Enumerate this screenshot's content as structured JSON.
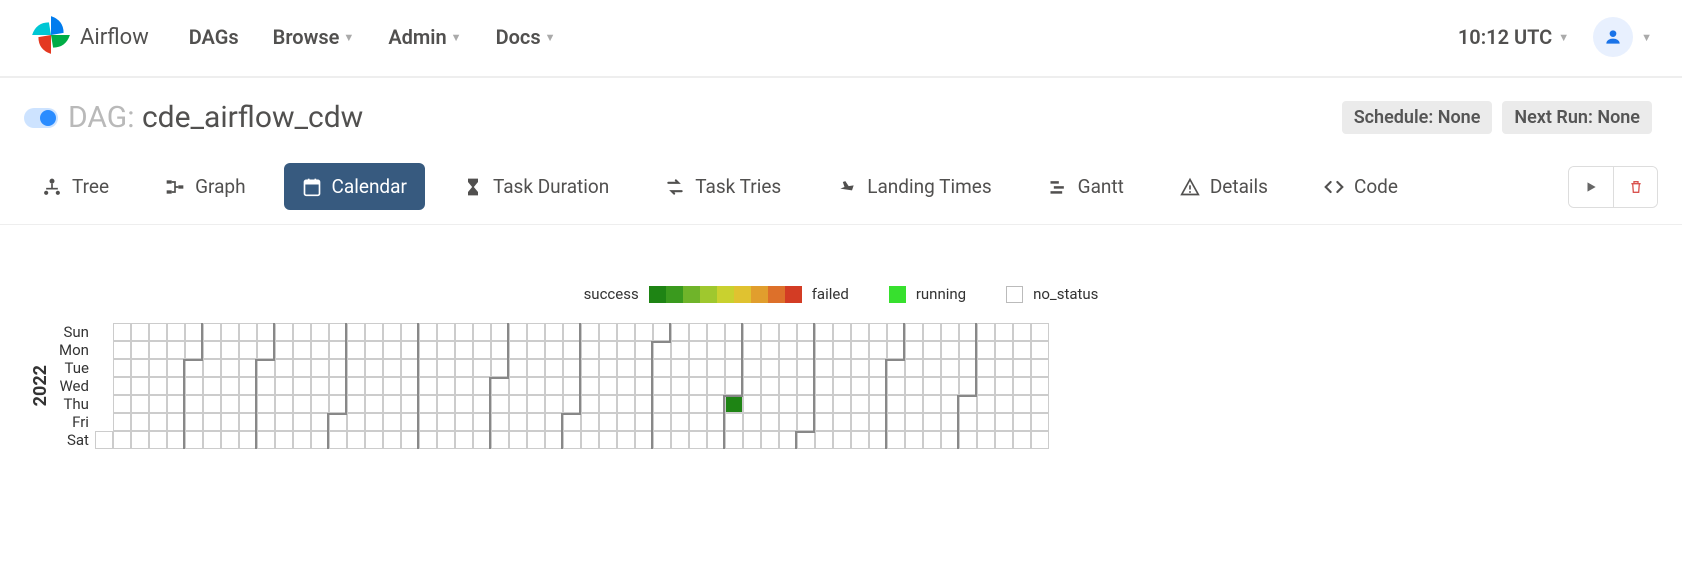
{
  "brand": "Airflow",
  "nav": {
    "items": [
      "DAGs",
      "Browse",
      "Admin",
      "Docs"
    ],
    "dropdowns": [
      false,
      true,
      true,
      true
    ],
    "clock": "10:12 UTC"
  },
  "dag": {
    "label_prefix": "DAG:",
    "name": "cde_airflow_cdw",
    "schedule_label": "Schedule: None",
    "next_run_label": "Next Run: None"
  },
  "tabs": [
    {
      "id": "tree",
      "label": "Tree"
    },
    {
      "id": "graph",
      "label": "Graph"
    },
    {
      "id": "calendar",
      "label": "Calendar"
    },
    {
      "id": "task-duration",
      "label": "Task Duration"
    },
    {
      "id": "task-tries",
      "label": "Task Tries"
    },
    {
      "id": "landing-times",
      "label": "Landing Times"
    },
    {
      "id": "gantt",
      "label": "Gantt"
    },
    {
      "id": "details",
      "label": "Details"
    },
    {
      "id": "code",
      "label": "Code"
    }
  ],
  "active_tab": "calendar",
  "legend": {
    "success": "success",
    "failed": "failed",
    "running": "running",
    "no_status": "no_status",
    "gradient_colors": [
      "#1e8414",
      "#3a9a1e",
      "#6fb42a",
      "#9fc82e",
      "#c9d12f",
      "#e0c230",
      "#e19e2d",
      "#dd702a",
      "#d33c24"
    ],
    "running_color": "#37e02e"
  },
  "calendar": {
    "year": "2022",
    "days_of_week": [
      "Sun",
      "Mon",
      "Tue",
      "Wed",
      "Thu",
      "Fri",
      "Sat"
    ],
    "first_day_dow": 6,
    "total_days": 365,
    "month_lengths": [
      31,
      28,
      31,
      30,
      31,
      30,
      31,
      31,
      30,
      31,
      30,
      31
    ],
    "filled_days": [
      244
    ]
  }
}
